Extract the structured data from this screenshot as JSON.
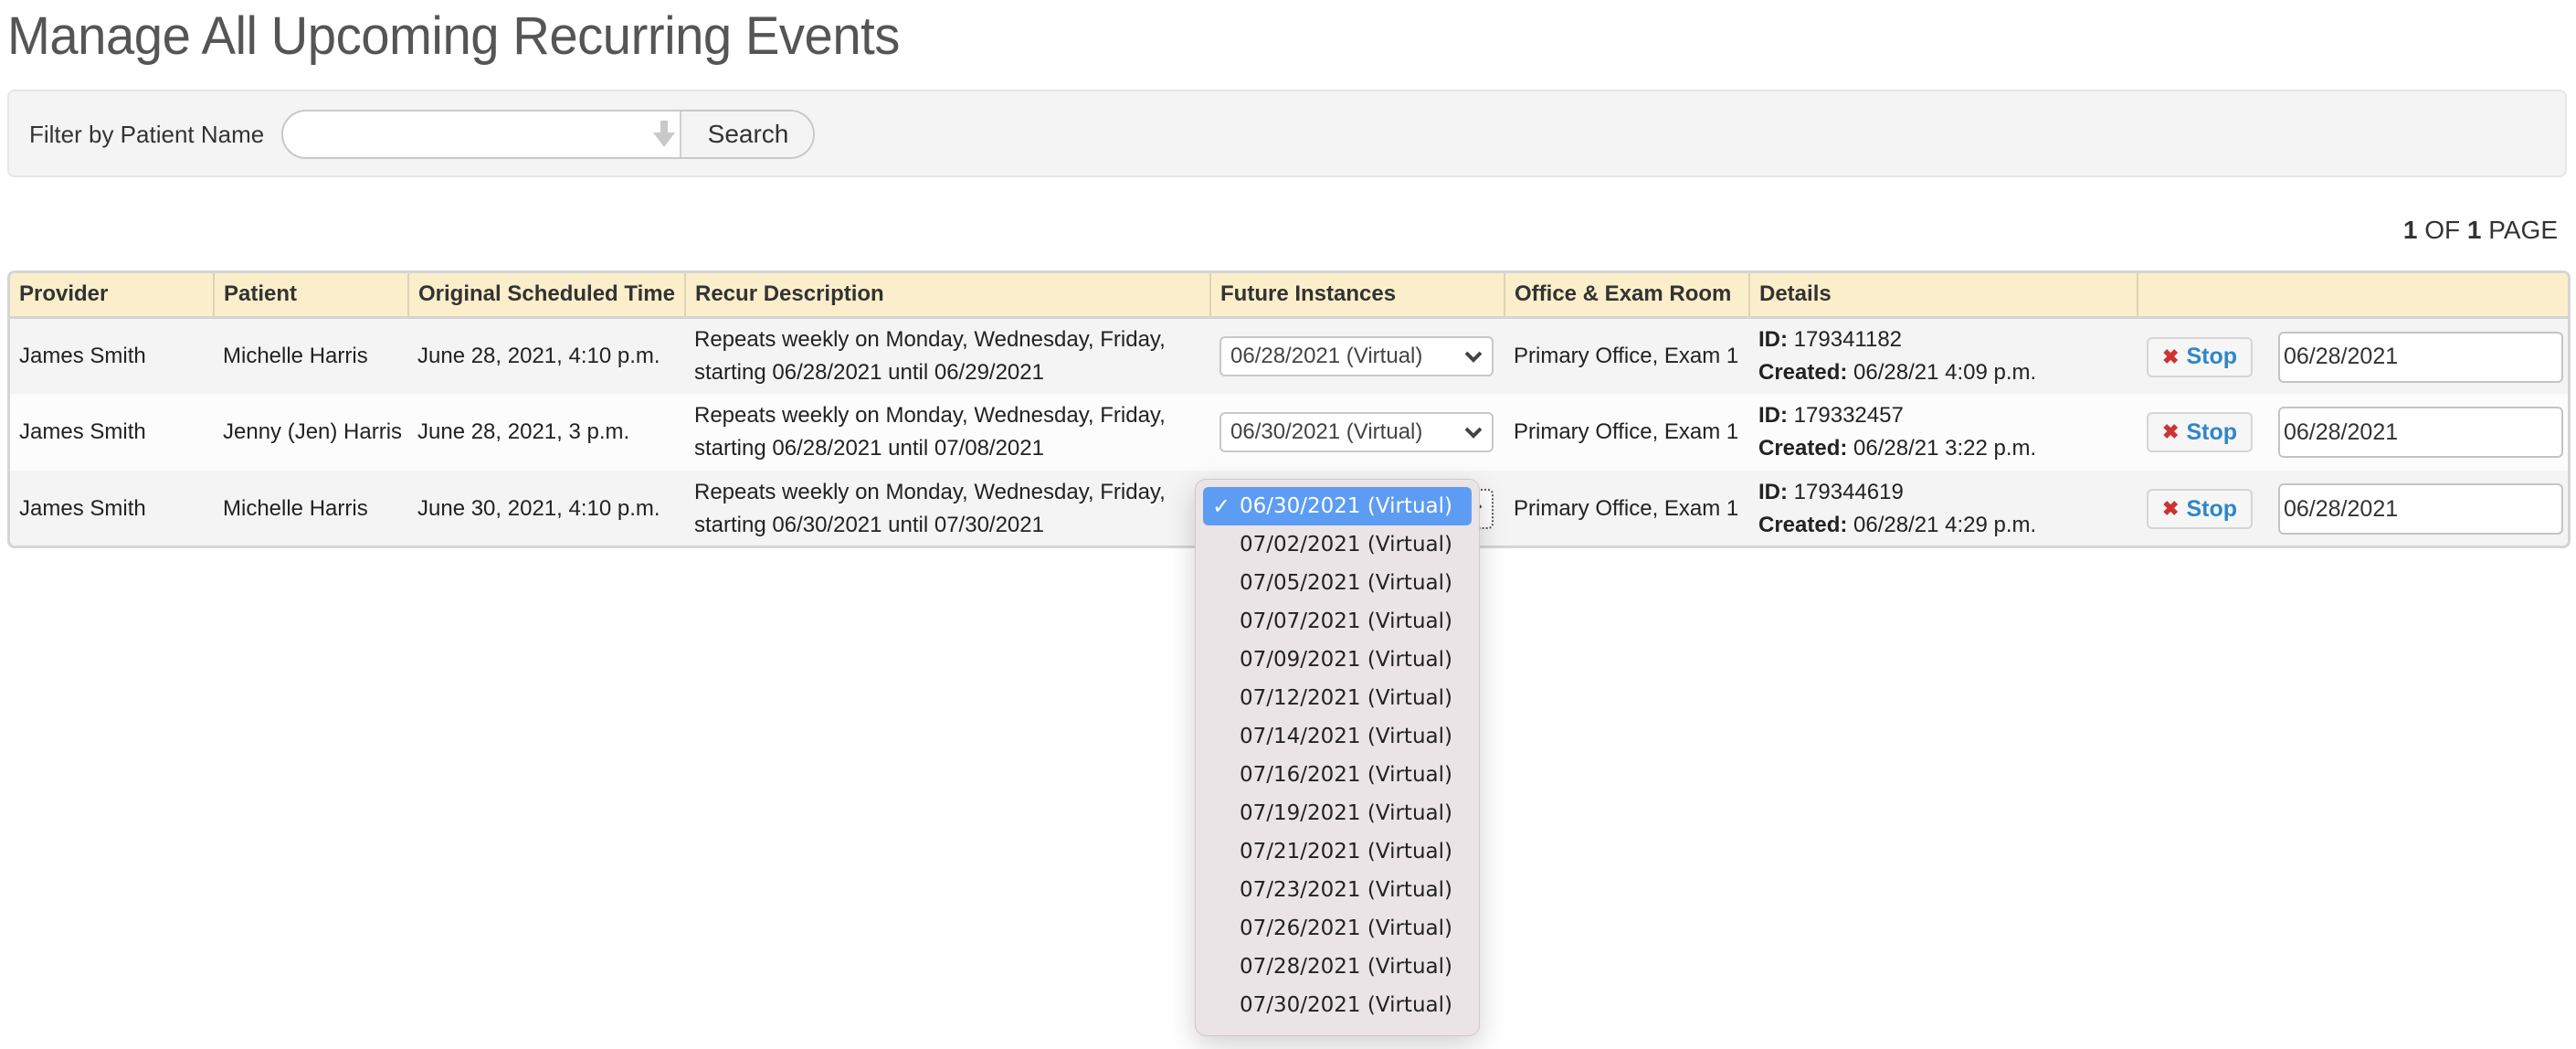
{
  "page": {
    "title": "Manage All Upcoming Recurring Events"
  },
  "filter": {
    "label": "Filter by Patient Name",
    "input_value": "",
    "input_placeholder": "",
    "search_label": "Search"
  },
  "pager": {
    "current": "1",
    "of_label": "OF",
    "total": "1",
    "page_label": "PAGE"
  },
  "table": {
    "columns": [
      "Provider",
      "Patient",
      "Original Scheduled Time",
      "Recur Description",
      "Future Instances",
      "Office & Exam Room",
      "Details",
      ""
    ],
    "rows": [
      {
        "provider": "James Smith",
        "patient": "Michelle Harris",
        "original_time": "June 28, 2021, 4:10 p.m.",
        "recur_line1": "Repeats weekly on Monday, Wednesday, Friday,",
        "recur_line2": "starting 06/28/2021 until 06/29/2021",
        "future_instance": "06/28/2021 (Virtual)",
        "office": "Primary Office, Exam 1",
        "id_label": "ID:",
        "id": "179341182",
        "created_label": "Created:",
        "created": "06/28/21 4:09 p.m.",
        "stop_label": "Stop",
        "stop_date": "06/28/2021"
      },
      {
        "provider": "James Smith",
        "patient": "Jenny (Jen) Harris",
        "original_time": "June 28, 2021, 3 p.m.",
        "recur_line1": "Repeats weekly on Monday, Wednesday, Friday,",
        "recur_line2": "starting 06/28/2021 until 07/08/2021",
        "future_instance": "06/30/2021 (Virtual)",
        "office": "Primary Office, Exam 1",
        "id_label": "ID:",
        "id": "179332457",
        "created_label": "Created:",
        "created": "06/28/21 3:22 p.m.",
        "stop_label": "Stop",
        "stop_date": "06/28/2021"
      },
      {
        "provider": "James Smith",
        "patient": "Michelle Harris",
        "original_time": "June 30, 2021, 4:10 p.m.",
        "recur_line1": "Repeats weekly on Monday, Wednesday, Friday,",
        "recur_line2": "starting 06/30/2021 until 07/30/2021",
        "future_instance": "06/30/2021 (Virtual)",
        "office": "Primary Office, Exam 1",
        "id_label": "ID:",
        "id": "179344619",
        "created_label": "Created:",
        "created": "06/28/21 4:29 p.m.",
        "stop_label": "Stop",
        "stop_date": "06/28/2021"
      }
    ]
  },
  "dropdown": {
    "selected_index": 0,
    "check_glyph": "✓",
    "options": [
      "06/30/2021 (Virtual)",
      "07/02/2021 (Virtual)",
      "07/05/2021 (Virtual)",
      "07/07/2021 (Virtual)",
      "07/09/2021 (Virtual)",
      "07/12/2021 (Virtual)",
      "07/14/2021 (Virtual)",
      "07/16/2021 (Virtual)",
      "07/19/2021 (Virtual)",
      "07/21/2021 (Virtual)",
      "07/23/2021 (Virtual)",
      "07/26/2021 (Virtual)",
      "07/28/2021 (Virtual)",
      "07/30/2021 (Virtual)"
    ]
  },
  "colors": {
    "header_bg": "#fbeecb",
    "stop_text": "#2f86c9",
    "stop_icon": "#cc3333",
    "dropdown_highlight": "#5d9cf3",
    "dropdown_bg": "#eae4e6"
  }
}
